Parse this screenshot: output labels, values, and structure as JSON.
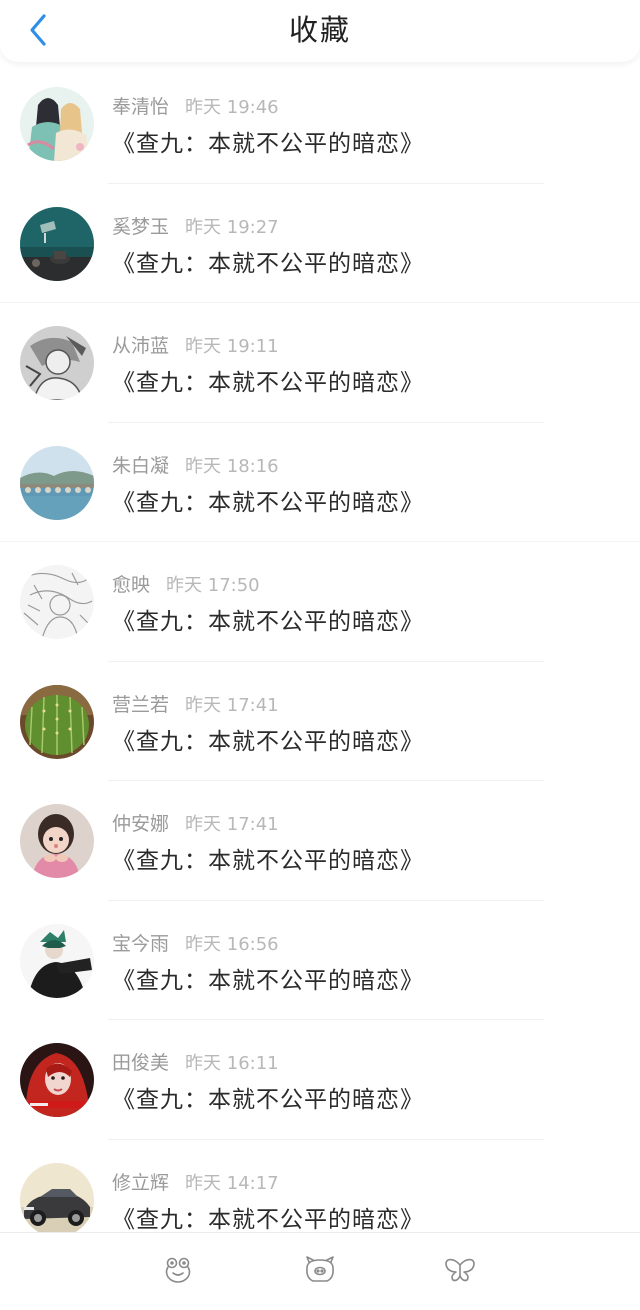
{
  "header": {
    "title": "收藏",
    "back_icon": "chevron-left-icon",
    "accent_color": "#2f8fe8"
  },
  "favorites": [
    {
      "name": "奉清怡",
      "time": "昨天 19:46",
      "message": "《查九：本就不公平的暗恋》",
      "avatar": "anime-couple-avatar"
    },
    {
      "name": "奚梦玉",
      "time": "昨天 19:27",
      "message": "《查九：本就不公平的暗恋》",
      "avatar": "teal-room-avatar"
    },
    {
      "name": "从沛蓝",
      "time": "昨天 19:11",
      "message": "《查九：本就不公平的暗恋》",
      "avatar": "sketch-avatar"
    },
    {
      "name": "朱白凝",
      "time": "昨天 18:16",
      "message": "《查九：本就不公平的暗恋》",
      "avatar": "bridge-lake-avatar"
    },
    {
      "name": "愈映",
      "time": "昨天 17:50",
      "message": "《查九：本就不公平的暗恋》",
      "avatar": "lineart-avatar"
    },
    {
      "name": "营兰若",
      "time": "昨天 17:41",
      "message": "《查九：本就不公平的暗恋》",
      "avatar": "cactus-avatar"
    },
    {
      "name": "仲安娜",
      "time": "昨天 17:41",
      "message": "《查九：本就不公平的暗恋》",
      "avatar": "child-avatar"
    },
    {
      "name": "宝今雨",
      "time": "昨天 16:56",
      "message": "《查九：本就不公平的暗恋》",
      "avatar": "dark-figure-avatar"
    },
    {
      "name": "田俊美",
      "time": "昨天 16:11",
      "message": "《查九：本就不公平的暗恋》",
      "avatar": "red-hair-girl-avatar"
    },
    {
      "name": "修立辉",
      "time": "昨天 14:17",
      "message": "《查九：本就不公平的暗恋》",
      "avatar": "car-avatar"
    }
  ],
  "tabbar": {
    "tabs": [
      {
        "icon": "frog-icon"
      },
      {
        "icon": "pig-icon"
      },
      {
        "icon": "butterfly-icon"
      }
    ]
  }
}
